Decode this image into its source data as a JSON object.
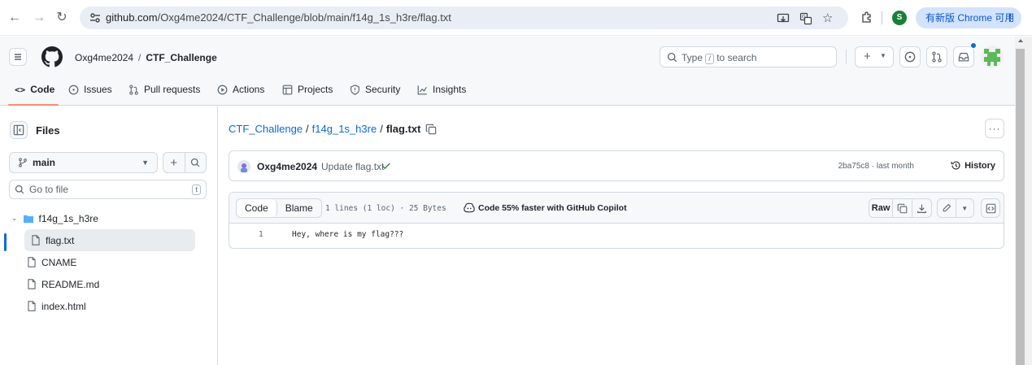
{
  "browser": {
    "url_host": "github.com",
    "url_path": "/Oxg4me2024/CTF_Challenge/blob/main/f14g_1s_h3re/flag.txt",
    "profile_initial": "S",
    "update_label": "有新版 Chrome 可用"
  },
  "header": {
    "owner": "Oxg4me2024",
    "separator": "/",
    "repo": "CTF_Challenge",
    "search_placeholder": "Type",
    "search_key": "/",
    "search_suffix": "to search",
    "plus_label": "+"
  },
  "repo_tabs": [
    {
      "label": "Code",
      "icon": "code-icon"
    },
    {
      "label": "Issues",
      "icon": "issue-icon"
    },
    {
      "label": "Pull requests",
      "icon": "pull-request-icon"
    },
    {
      "label": "Actions",
      "icon": "play-icon"
    },
    {
      "label": "Projects",
      "icon": "table-icon"
    },
    {
      "label": "Security",
      "icon": "shield-icon"
    },
    {
      "label": "Insights",
      "icon": "graph-icon"
    }
  ],
  "sidebar": {
    "title": "Files",
    "branch": "main",
    "goto_placeholder": "Go to file",
    "goto_key": "t",
    "tree": [
      {
        "name": "f14g_1s_h3re",
        "type": "folder",
        "expanded": true
      },
      {
        "name": "flag.txt",
        "type": "file",
        "selected": true
      },
      {
        "name": "CNAME",
        "type": "file"
      },
      {
        "name": "README.md",
        "type": "file"
      },
      {
        "name": "index.html",
        "type": "file"
      }
    ]
  },
  "breadcrumb": {
    "repo": "CTF_Challenge",
    "sep": "/",
    "folder": "f14g_1s_h3re",
    "file": "flag.txt"
  },
  "commit": {
    "author": "Oxg4me2024",
    "message": "Update flag.txt",
    "meta": "2ba75c8 · last month",
    "history_label": "History"
  },
  "file_view": {
    "tab_code": "Code",
    "tab_blame": "Blame",
    "info": "1 lines (1 loc) · 25 Bytes",
    "copilot": "Code 55% faster with GitHub Copilot",
    "raw_label": "Raw",
    "lines": [
      {
        "no": "1",
        "text": "Hey, where is my flag???"
      }
    ]
  },
  "colors": {
    "link": "#0969da",
    "tab_underline": "#fd8c73",
    "success": "#1a7f37",
    "border": "#d1d9e0"
  }
}
